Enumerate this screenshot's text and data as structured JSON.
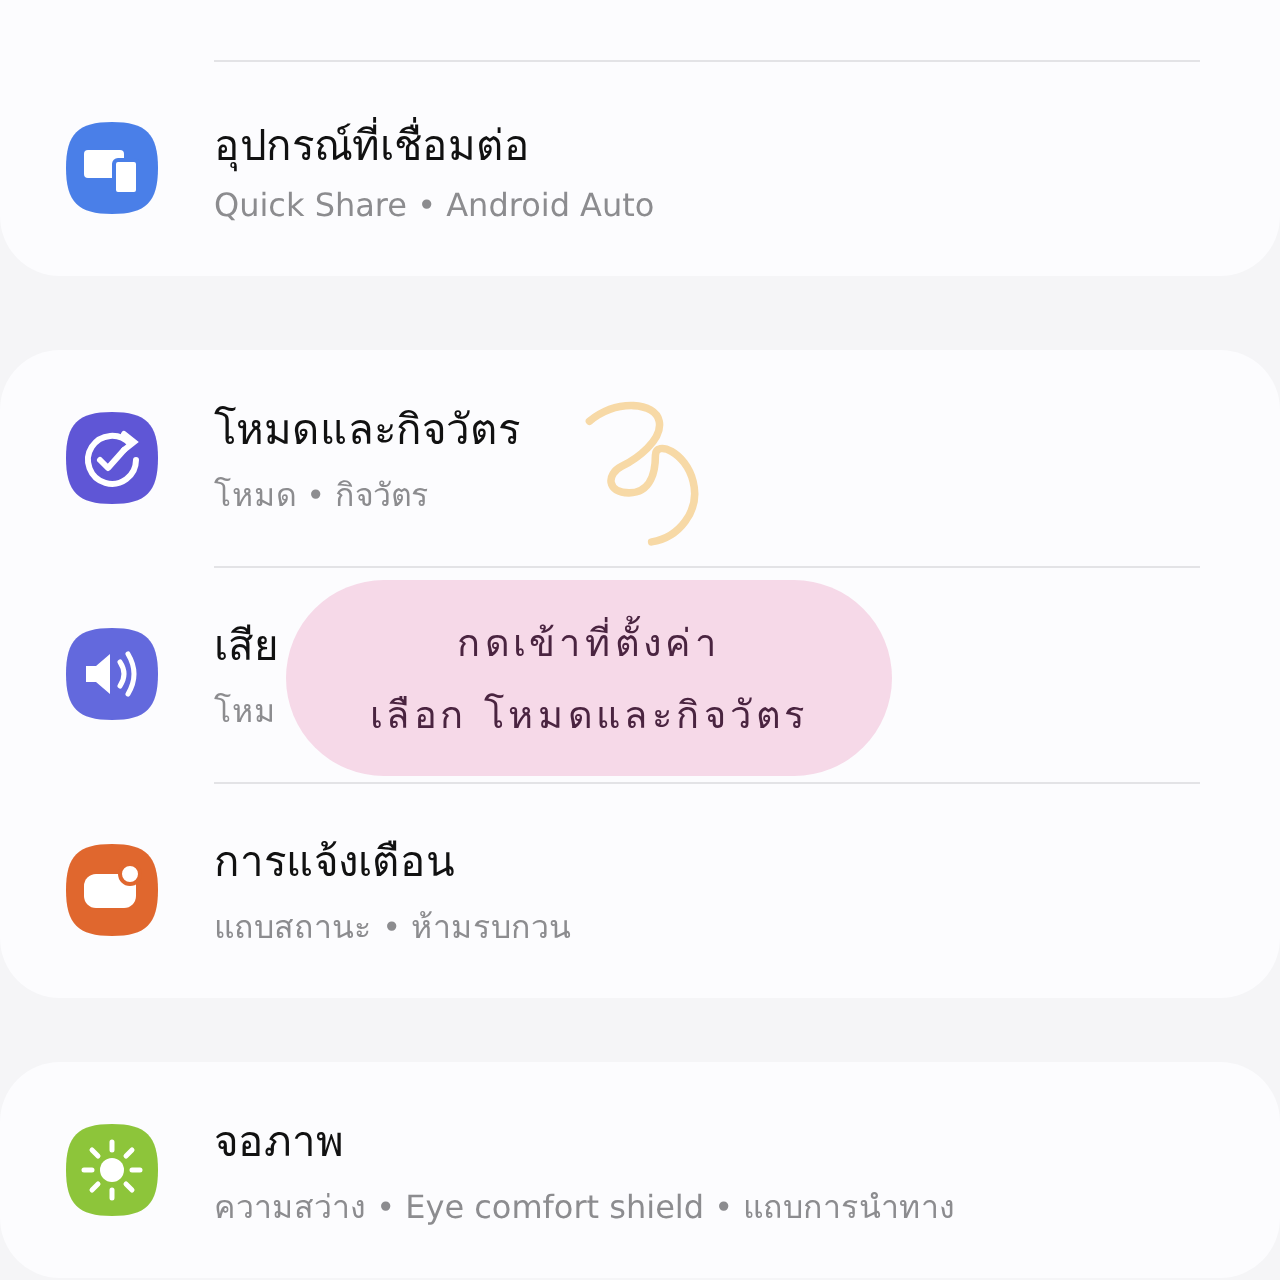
{
  "groups": [
    {
      "items": [
        {
          "kind": "devices",
          "title": "อุปกรณ์ที่เชื่อมต่อ",
          "subtitle": "Quick Share • Android Auto"
        }
      ]
    },
    {
      "items": [
        {
          "kind": "modes",
          "title": "โหมดและกิจวัตร",
          "subtitle": "โหมด • กิจวัตร"
        },
        {
          "kind": "sound",
          "title": "เสีย",
          "subtitle": "โหม"
        },
        {
          "kind": "notifications",
          "title": "การแจ้งเตือน",
          "subtitle": "แถบสถานะ • ห้ามรบกวน"
        }
      ]
    },
    {
      "items": [
        {
          "kind": "display",
          "title": "จอภาพ",
          "subtitle": "ความสว่าง • Eye comfort shield • แถบการนำทาง"
        }
      ]
    }
  ],
  "caption": {
    "lines": [
      "กดเข้าที่ตั้งค่า",
      "เลือก โหมดและกิจวัตร"
    ]
  }
}
